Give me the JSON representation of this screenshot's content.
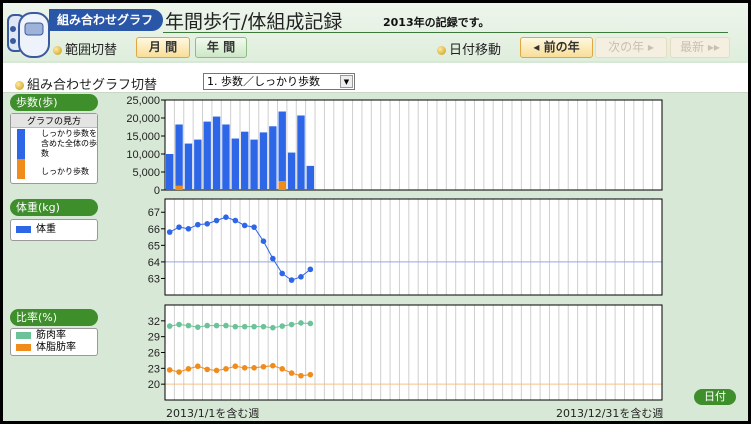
{
  "header": {
    "badge": "組み合わせグラフ",
    "title": "年間歩行/体組成記録",
    "subtitle": "2013年の記録です。"
  },
  "range": {
    "label": "範囲切替",
    "month": "月 間",
    "year": "年 間"
  },
  "nav": {
    "label": "日付移動",
    "prev": "◂ 前の年",
    "next": "次の年 ▸",
    "latest": "最新 ▸▸"
  },
  "combo": {
    "label": "組み合わせグラフ切替",
    "selected": "1. 歩数／しっかり歩数"
  },
  "steps_panel": {
    "title": "歩数(歩)",
    "guide_title": "グラフの見方",
    "guide_total": "しっかり歩数を含めた全体の歩数",
    "guide_firm": "しっかり歩数"
  },
  "weight_panel": {
    "title": "体重(kg)",
    "legend": "体重"
  },
  "ratio_panel": {
    "title": "比率(%)",
    "legend_muscle": "筋肉率",
    "legend_fat": "体脂肪率"
  },
  "footer": {
    "start": "2013/1/1を含む週",
    "end": "2013/12/31を含む週",
    "date_button": "日付"
  },
  "colors": {
    "blue": "#2e66e8",
    "orange": "#f08c1c",
    "green": "#6cc39a",
    "accent": "#3f8e2c"
  },
  "chart_data": [
    {
      "type": "bar",
      "title": "歩数(歩)",
      "weeks": 53,
      "ylim": [
        0,
        25000
      ],
      "yticks": [
        "0",
        "5,000",
        "10,000",
        "15,000",
        "20,000",
        "25,000"
      ],
      "ytick_values": [
        0,
        5000,
        10000,
        15000,
        20000,
        25000
      ],
      "series": [
        {
          "name": "全体の歩数",
          "values": [
            10000,
            18200,
            12900,
            14000,
            19000,
            20400,
            18200,
            14300,
            16200,
            14000,
            16000,
            17700,
            21800,
            10400,
            20700,
            6700
          ]
        },
        {
          "name": "しっかり歩数",
          "values": [
            0,
            1200,
            0,
            0,
            0,
            0,
            0,
            0,
            0,
            0,
            0,
            0,
            2500,
            0,
            0,
            0
          ]
        }
      ]
    },
    {
      "type": "line",
      "title": "体重(kg)",
      "weeks": 53,
      "ylim": [
        62,
        67.8
      ],
      "yticks": [
        "63",
        "64",
        "65",
        "66",
        "67"
      ],
      "ytick_values": [
        63,
        64,
        65,
        66,
        67
      ],
      "reference": 64,
      "series": [
        {
          "name": "体重",
          "values": [
            65.8,
            66.1,
            66.0,
            66.25,
            66.3,
            66.5,
            66.7,
            66.5,
            66.2,
            66.1,
            65.25,
            64.2,
            63.3,
            62.9,
            63.1,
            63.55
          ]
        }
      ]
    },
    {
      "type": "line",
      "title": "比率(%)",
      "weeks": 53,
      "ylim": [
        17,
        35
      ],
      "yticks": [
        "20",
        "23",
        "26",
        "29",
        "32"
      ],
      "ytick_values": [
        20,
        23,
        26,
        29,
        32
      ],
      "reference": 20,
      "series": [
        {
          "name": "筋肉率",
          "values": [
            31.0,
            31.3,
            31.1,
            30.8,
            31.1,
            31.1,
            31.1,
            30.9,
            30.9,
            30.9,
            30.9,
            30.7,
            31.0,
            31.3,
            31.6,
            31.5
          ]
        },
        {
          "name": "体脂肪率",
          "values": [
            22.7,
            22.3,
            22.9,
            23.4,
            22.8,
            22.6,
            22.9,
            23.4,
            23.1,
            23.1,
            23.3,
            23.5,
            22.9,
            22.1,
            21.6,
            21.8
          ]
        }
      ]
    }
  ]
}
